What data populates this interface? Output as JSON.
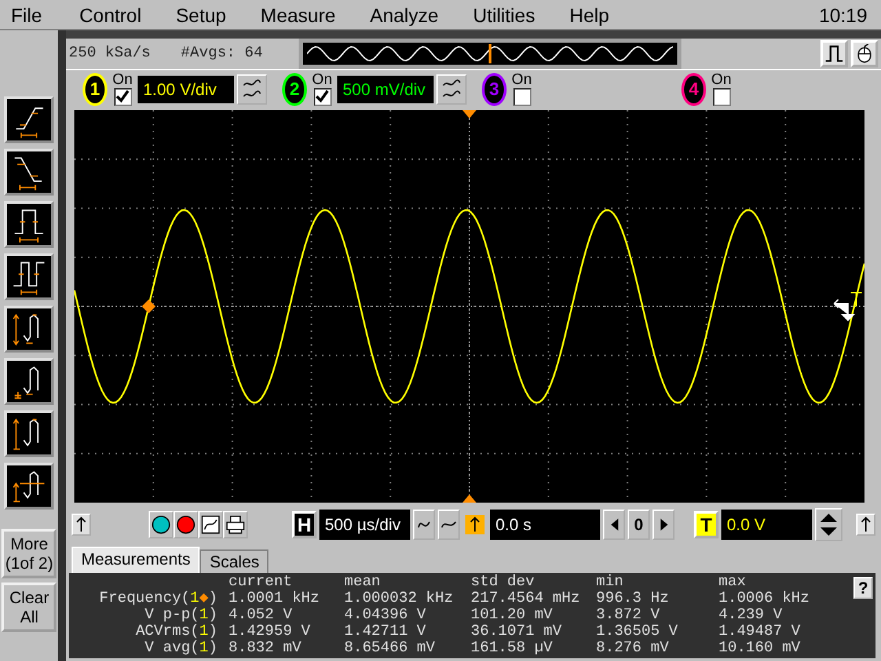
{
  "menu": [
    {
      "label": "File"
    },
    {
      "label": "Control"
    },
    {
      "label": "Setup"
    },
    {
      "label": "Measure"
    },
    {
      "label": "Analyze"
    },
    {
      "label": "Utilities"
    },
    {
      "label": "Help"
    }
  ],
  "clock": "10:19",
  "sidebar": {
    "more_button": "More (1of 2)",
    "clear_button": "Clear All"
  },
  "acquisition": {
    "sample_rate": "250 kSa/s",
    "averages": "#Avgs: 64"
  },
  "channels": [
    {
      "number": "1",
      "on_label": "On",
      "on": true,
      "scale": "1.00 V/div",
      "color": "#ffff00"
    },
    {
      "number": "2",
      "on_label": "On",
      "on": true,
      "scale": "500 mV/div",
      "color": "#00ff00"
    },
    {
      "number": "3",
      "on_label": "On",
      "on": false,
      "color": "#a000ff"
    },
    {
      "number": "4",
      "on_label": "On",
      "on": false,
      "color": "#ff0080"
    }
  ],
  "timebase": {
    "label": "H",
    "scale": "500 µs/div",
    "delay": "0.0 s",
    "reference": "0"
  },
  "trigger": {
    "label": "T",
    "level": "0.0 V"
  },
  "tabs": [
    {
      "label": "Measurements",
      "selected": true
    },
    {
      "label": "Scales",
      "selected": false
    }
  ],
  "measurements": {
    "help": "?",
    "columns": [
      "current",
      "mean",
      "std dev",
      "min",
      "max"
    ],
    "rows": [
      {
        "label_parts": [
          {
            "text": "Frequency(",
            "kind": "plain"
          },
          {
            "text": "1",
            "kind": "source"
          },
          {
            "text": "◆",
            "kind": "marker"
          },
          {
            "text": ")",
            "kind": "plain"
          }
        ],
        "values": [
          "1.0001 kHz",
          "1.000032 kHz",
          "217.4564 mHz",
          "996.3 Hz",
          "1.0006 kHz"
        ]
      },
      {
        "label_parts": [
          {
            "text": "V p-p(",
            "kind": "plain"
          },
          {
            "text": "1",
            "kind": "source"
          },
          {
            "text": ")",
            "kind": "plain"
          }
        ],
        "values": [
          "4.052 V",
          "4.04396 V",
          "101.20 mV",
          "3.872 V",
          "4.239 V"
        ]
      },
      {
        "label_parts": [
          {
            "text": "ACVrms(",
            "kind": "plain"
          },
          {
            "text": "1",
            "kind": "source"
          },
          {
            "text": ")",
            "kind": "plain"
          }
        ],
        "values": [
          "1.42959 V",
          "1.42711 V",
          "36.1071 mV",
          "1.36505 V",
          "1.49487 V"
        ]
      },
      {
        "label_parts": [
          {
            "text": "V avg(",
            "kind": "plain"
          },
          {
            "text": "1",
            "kind": "source"
          },
          {
            "text": ")",
            "kind": "plain"
          }
        ],
        "values": [
          "8.832 mV",
          "8.65466 mV",
          "161.58 µV",
          "8.276 mV",
          "10.160 mV"
        ]
      }
    ]
  }
}
